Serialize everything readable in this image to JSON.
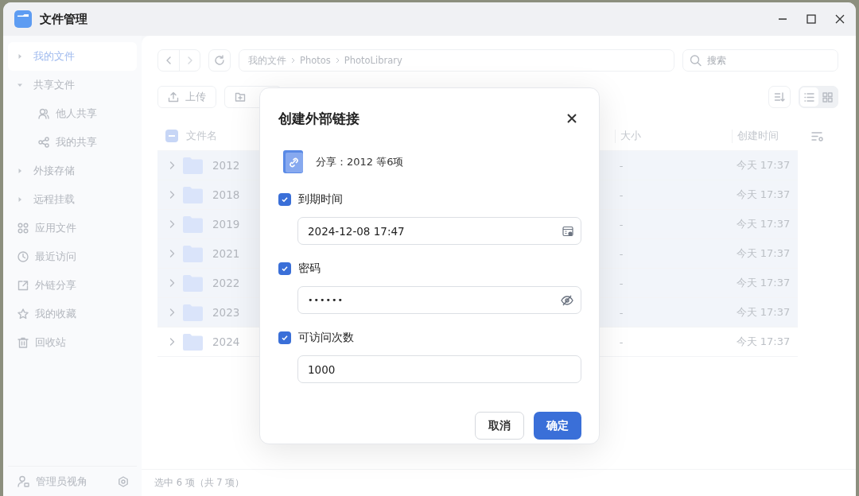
{
  "window": {
    "title": "文件管理"
  },
  "sidebar": {
    "items": [
      {
        "label": "我的文件",
        "selected": true,
        "expanded": false,
        "kind": "group"
      },
      {
        "label": "共享文件",
        "selected": false,
        "expanded": true,
        "kind": "group",
        "children": [
          {
            "label": "他人共享",
            "selected": false
          },
          {
            "label": "我的共享",
            "selected": false
          }
        ]
      },
      {
        "label": "外接存储",
        "selected": false,
        "expanded": false,
        "kind": "group"
      },
      {
        "label": "远程挂载",
        "selected": false,
        "expanded": false,
        "kind": "group"
      },
      {
        "label": "应用文件",
        "selected": false,
        "kind": "link"
      },
      {
        "label": "最近访问",
        "selected": false,
        "kind": "link"
      },
      {
        "label": "外链分享",
        "selected": false,
        "kind": "link"
      },
      {
        "label": "我的收藏",
        "selected": false,
        "kind": "link"
      },
      {
        "label": "回收站",
        "selected": false,
        "kind": "link"
      }
    ],
    "footer": {
      "label": "管理员视角"
    }
  },
  "toolbar": {
    "path": [
      "我的文件",
      "Photos",
      "PhotoLibrary"
    ],
    "search": {
      "placeholder": "搜索"
    },
    "actions": [
      "上传"
    ],
    "view": [
      {
        "kind": "list",
        "selected": true
      },
      {
        "kind": "grid",
        "selected": false
      }
    ]
  },
  "table": {
    "columns": [
      "文件名",
      "大小",
      "创建时间"
    ],
    "header_checkbox": {
      "checked": false,
      "indeterminate": true
    },
    "rows": [
      {
        "name": "2012",
        "size": "-",
        "created": "今天 17:37",
        "selected": true
      },
      {
        "name": "2018",
        "size": "-",
        "created": "今天 17:37",
        "selected": true
      },
      {
        "name": "2019",
        "size": "-",
        "created": "今天 17:37",
        "selected": true
      },
      {
        "name": "2021",
        "size": "-",
        "created": "今天 17:37",
        "selected": true
      },
      {
        "name": "2022",
        "size": "-",
        "created": "今天 17:37",
        "selected": true
      },
      {
        "name": "2023",
        "size": "-",
        "created": "今天 17:37",
        "selected": true
      },
      {
        "name": "2024",
        "size": "-",
        "created": "今天 17:37",
        "selected": false
      }
    ]
  },
  "status_bar": "选中 6 项（共 7 项）",
  "dialog": {
    "title": "创建外部链接",
    "summary": "分享：2012 等6项",
    "options": [
      {
        "label": "到期时间",
        "checked": true,
        "kind": "date",
        "value": "2024-12-08 17:47"
      },
      {
        "label": "密码",
        "checked": true,
        "kind": "password",
        "value": "••••••"
      },
      {
        "label": "可访问次数",
        "checked": true,
        "kind": "number",
        "value": "1000"
      }
    ],
    "buttons": [
      {
        "label": "取消",
        "kind": "secondary"
      },
      {
        "label": "确定",
        "kind": "primary"
      }
    ]
  }
}
